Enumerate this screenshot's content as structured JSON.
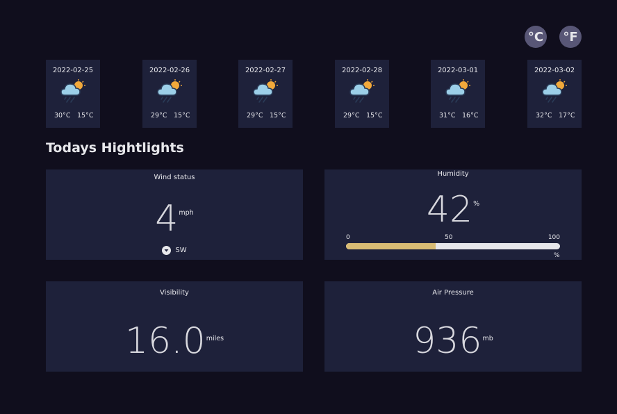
{
  "units": {
    "celsius_label": "°C",
    "fahrenheit_label": "°F",
    "selected": "celsius"
  },
  "forecast": [
    {
      "date": "2022-02-25",
      "max": "30°C",
      "min": "15°C",
      "icon": "rain-sun-cloud-icon"
    },
    {
      "date": "2022-02-26",
      "max": "29°C",
      "min": "15°C",
      "icon": "rain-sun-cloud-icon"
    },
    {
      "date": "2022-02-27",
      "max": "29°C",
      "min": "15°C",
      "icon": "rain-sun-cloud-icon"
    },
    {
      "date": "2022-02-28",
      "max": "29°C",
      "min": "15°C",
      "icon": "rain-sun-cloud-icon"
    },
    {
      "date": "2022-03-01",
      "max": "31°C",
      "min": "16°C",
      "icon": "rain-sun-cloud-icon"
    },
    {
      "date": "2022-03-02",
      "max": "32°C",
      "min": "17°C",
      "icon": "rain-sun-cloud-icon"
    }
  ],
  "highlights": {
    "title": "Todays Hightlights",
    "wind": {
      "label": "Wind status",
      "value": "4",
      "unit": "mph",
      "direction": "SW",
      "icon": "wind-direction-icon"
    },
    "humidity": {
      "label": "Humidity",
      "value": "42",
      "unit": "%",
      "percent": 42,
      "scale": [
        "0",
        "50",
        "100"
      ],
      "scale_unit": "%"
    },
    "visibility": {
      "label": "Visibility",
      "value": "16.0",
      "unit": "miles"
    },
    "pressure": {
      "label": "Air Pressure",
      "value": "936",
      "unit": "mb"
    }
  },
  "colors": {
    "background": "#100e1d",
    "card": "#1e213a",
    "toggle": "#585676",
    "bar_fill": "#d8bb74",
    "bar_track": "#e7e7eb",
    "text": "#e7e7eb"
  }
}
